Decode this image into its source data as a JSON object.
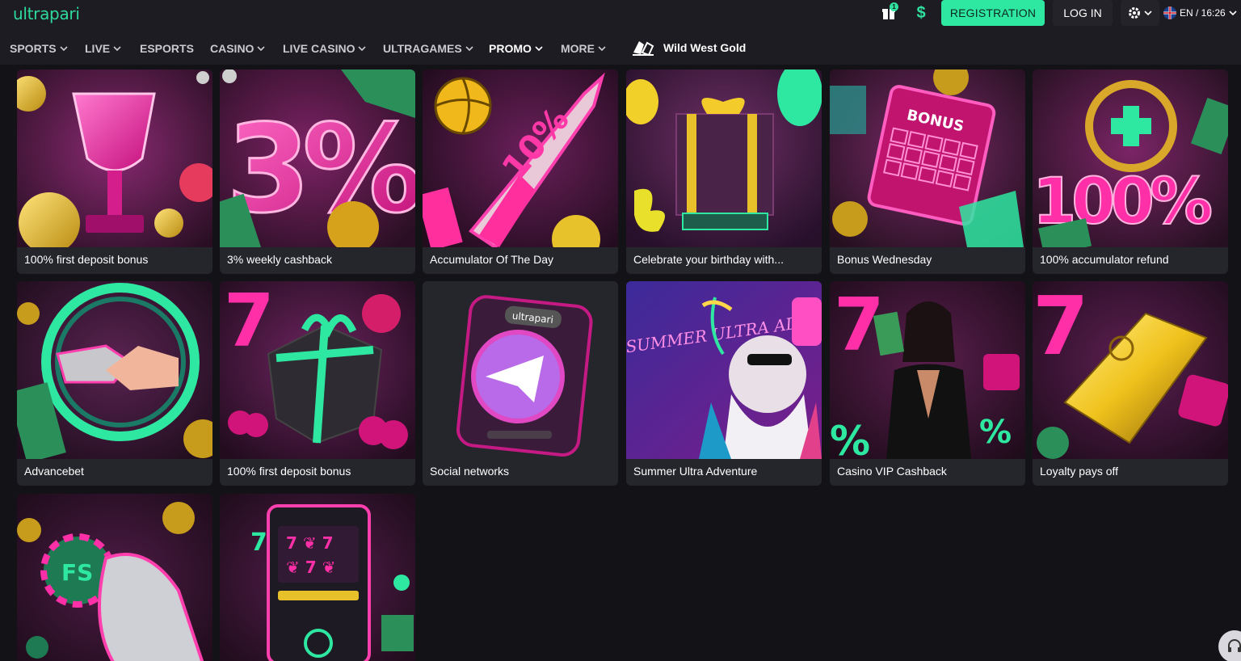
{
  "header": {
    "logo": "ultrapari",
    "gift_badge": "1",
    "dollar_icon": "$",
    "registration": "REGISTRATION",
    "login": "LOG IN",
    "lang_time": "EN / 16:26"
  },
  "nav": {
    "items": [
      {
        "label": "SPORTS",
        "dropdown": true
      },
      {
        "label": "LIVE",
        "dropdown": true
      },
      {
        "label": "ESPORTS",
        "dropdown": false
      },
      {
        "label": "CASINO",
        "dropdown": true
      },
      {
        "label": "LIVE CASINO",
        "dropdown": true
      },
      {
        "label": "ULTRAGAMES",
        "dropdown": true
      },
      {
        "label": "PROMO",
        "dropdown": true,
        "active": true
      },
      {
        "label": "MORE",
        "dropdown": true
      }
    ],
    "featured": "Wild West Gold"
  },
  "promos": [
    {
      "title": "100% first deposit bonus",
      "icon": "trophy-icon"
    },
    {
      "title": "3% weekly cashback",
      "icon": "percent-icon",
      "art_text": "3%"
    },
    {
      "title": "Accumulator Of The Day",
      "icon": "rocket-icon",
      "art_text": "10%"
    },
    {
      "title": "Celebrate your birthday with...",
      "icon": "gift-icon"
    },
    {
      "title": "Bonus Wednesday",
      "icon": "calendar-icon",
      "art_text": "BONUS"
    },
    {
      "title": "100% accumulator refund",
      "icon": "refund-icon",
      "art_text": "100%"
    },
    {
      "title": "Advancebet",
      "icon": "handshake-icon"
    },
    {
      "title": "100% first deposit bonus",
      "icon": "gift-box-icon"
    },
    {
      "title": "Social networks",
      "icon": "telegram-icon",
      "art_text": "ultrapari"
    },
    {
      "title": "Summer Ultra Adventure",
      "icon": "palm-icon",
      "art_text": "SUMMER ULTRA ADVENTURE"
    },
    {
      "title": "Casino VIP Cashback",
      "icon": "cashback-icon"
    },
    {
      "title": "Loyalty pays off",
      "icon": "gold-bar-icon"
    },
    {
      "title": "",
      "icon": "free-spins-icon",
      "art_text": "FS"
    },
    {
      "title": "",
      "icon": "slot-machine-icon"
    }
  ],
  "colors": {
    "accent": "#2ee8a2",
    "background": "#131217",
    "bar": "#1c1c22",
    "card": "#25252c",
    "pink": "#ff2fa8",
    "purple": "#5a1d4e"
  }
}
